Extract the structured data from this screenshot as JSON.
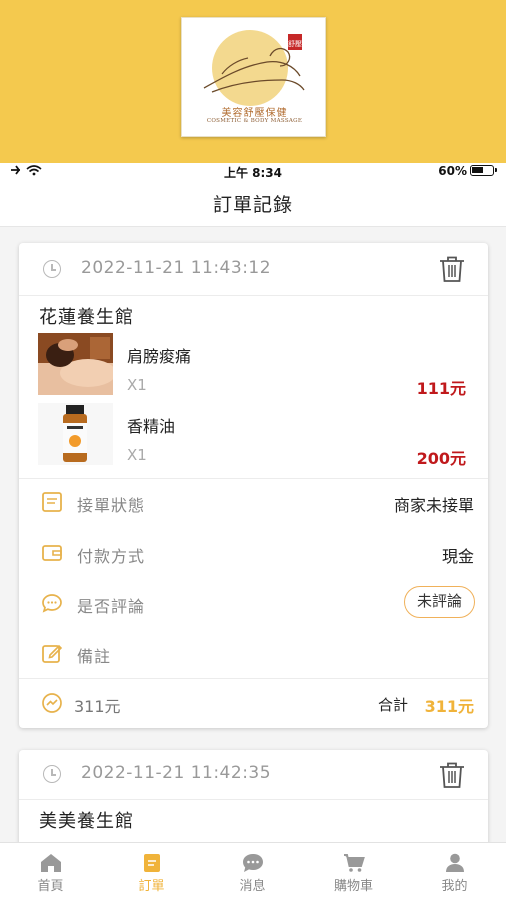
{
  "brand": {
    "name_cn": "美容舒壓保健",
    "name_en": "COSMETIC & BODY MASSAGE",
    "seal": "舒壓",
    "accent": "#f4c94e"
  },
  "status_bar": {
    "time": "上午 8:34",
    "battery": "60%"
  },
  "page_title": "訂單記錄",
  "orders": [
    {
      "timestamp": "2022-11-21 11:43:12",
      "shop": "花蓮養生館",
      "items": [
        {
          "name": "肩膀痠痛",
          "qty": "X1",
          "price": "111元",
          "image": "massage-photo"
        },
        {
          "name": "香精油",
          "qty": "X1",
          "price": "200元",
          "image": "essential-oil-bottle"
        }
      ],
      "status_label": "接單狀態",
      "status_value": "商家未接單",
      "payment_label": "付款方式",
      "payment_value": "現金",
      "review_label": "是否評論",
      "review_value": "未評論",
      "note_label": "備註",
      "subtotal": "311元",
      "total_label": "合計",
      "total_value": "311元"
    },
    {
      "timestamp": "2022-11-21 11:42:35",
      "shop": "美美養生館"
    }
  ],
  "tabs": [
    {
      "label": "首頁",
      "icon": "home-icon",
      "active": false
    },
    {
      "label": "訂單",
      "icon": "orders-icon",
      "active": true
    },
    {
      "label": "消息",
      "icon": "chat-icon",
      "active": false
    },
    {
      "label": "購物車",
      "icon": "cart-icon",
      "active": false
    },
    {
      "label": "我的",
      "icon": "user-icon",
      "active": false
    }
  ],
  "colors": {
    "price_red": "#c0191c",
    "accent_gold": "#f0b33a",
    "icon_gold": "#e7b24c",
    "pill_border": "#f0b15a"
  }
}
